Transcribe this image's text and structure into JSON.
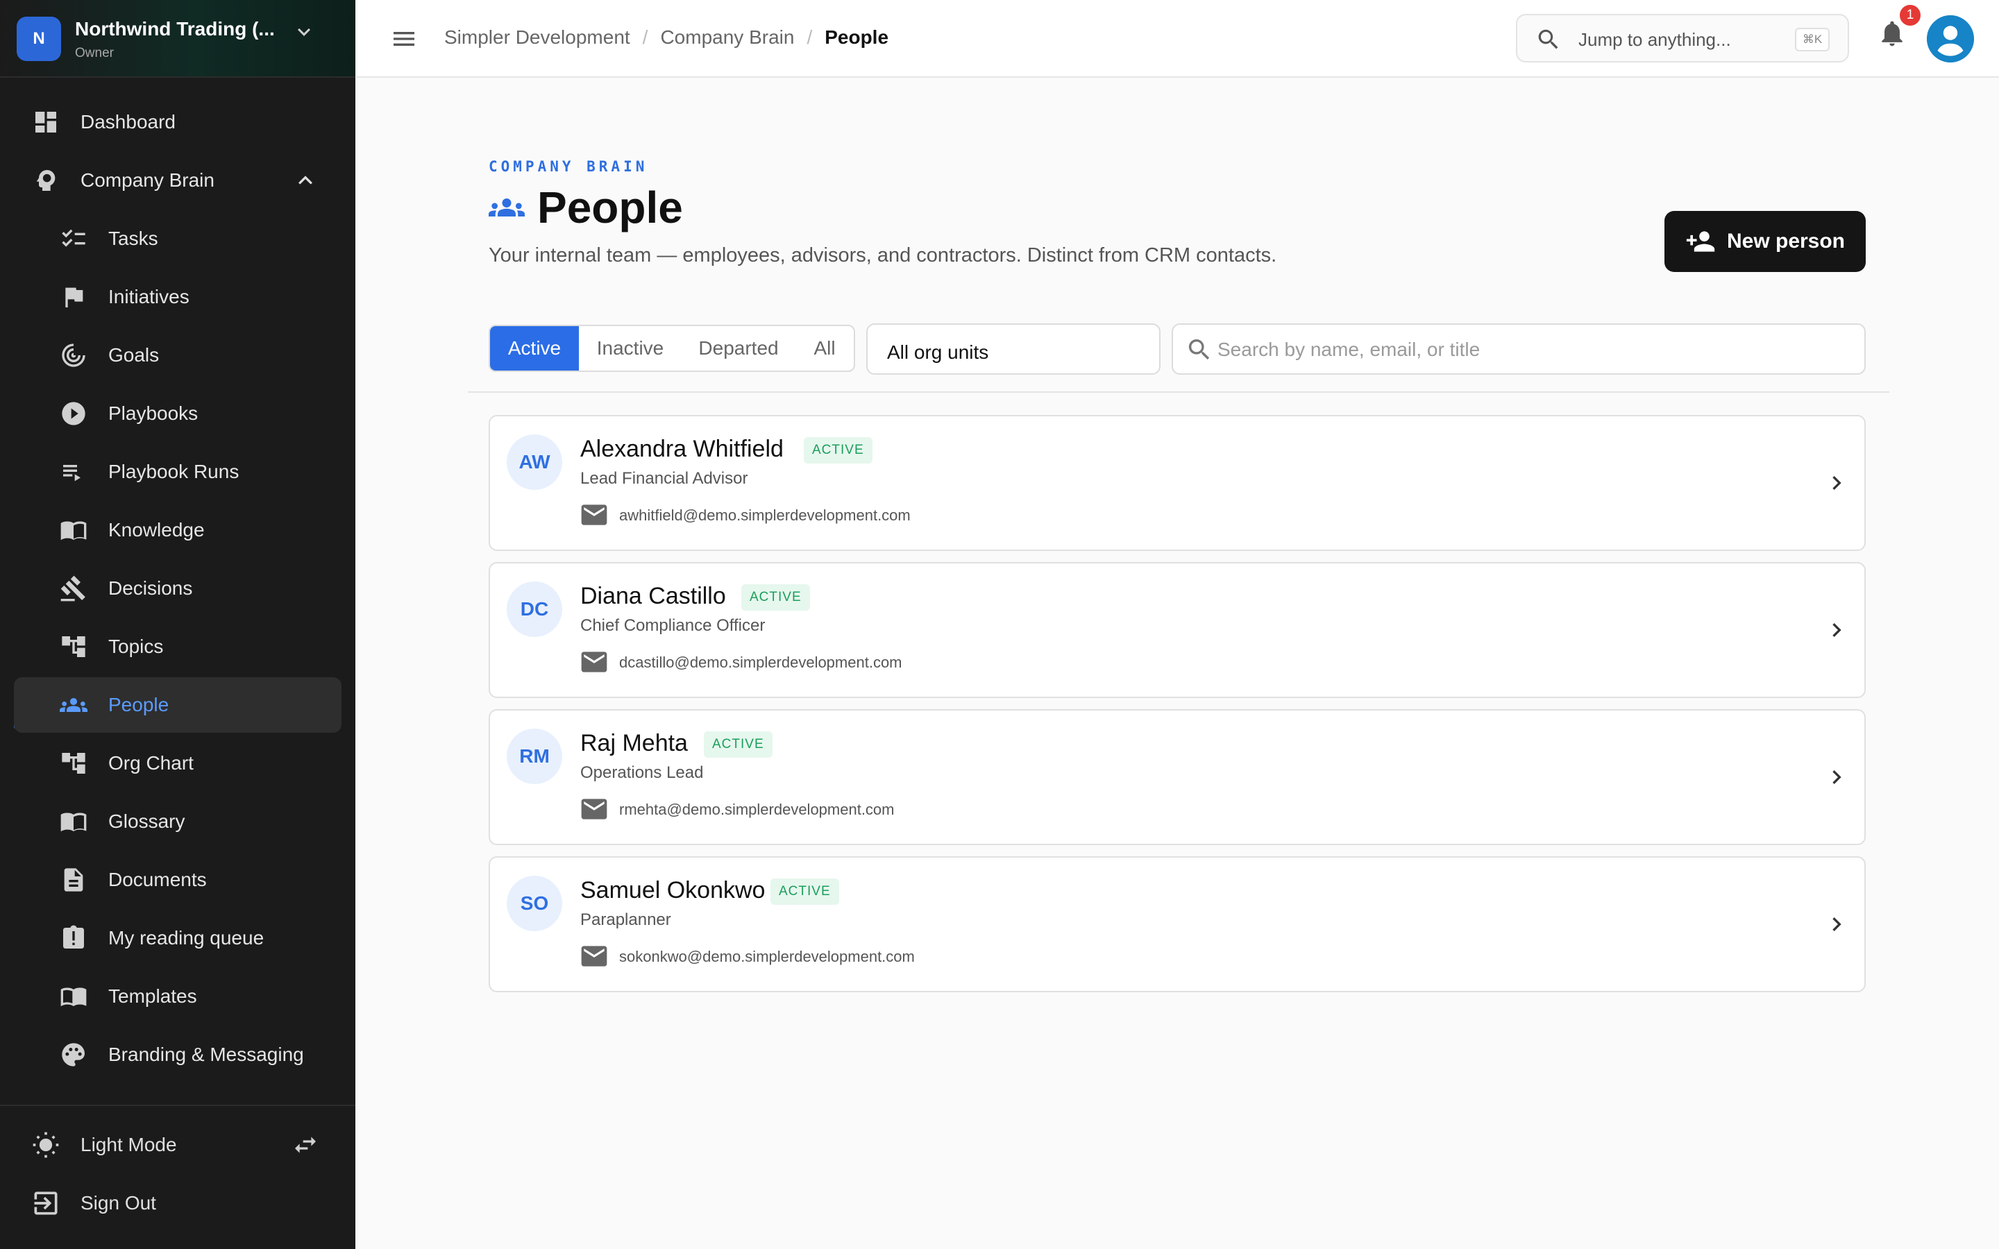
{
  "workspace": {
    "avatar": "N",
    "name": "Northwind Trading (...",
    "role": "Owner"
  },
  "sidebar": {
    "items": [
      {
        "label": "Dashboard",
        "icon": "dashboard-icon"
      },
      {
        "label": "Company Brain",
        "icon": "brain-icon",
        "expanded": true
      },
      {
        "label": "Tasks",
        "icon": "tasks-icon"
      },
      {
        "label": "Initiatives",
        "icon": "flag-icon"
      },
      {
        "label": "Goals",
        "icon": "target-icon"
      },
      {
        "label": "Playbooks",
        "icon": "play-icon"
      },
      {
        "label": "Playbook Runs",
        "icon": "playlist-icon"
      },
      {
        "label": "Knowledge",
        "icon": "book-icon"
      },
      {
        "label": "Decisions",
        "icon": "gavel-icon"
      },
      {
        "label": "Topics",
        "icon": "tree-icon"
      },
      {
        "label": "People",
        "icon": "people-icon",
        "active": true
      },
      {
        "label": "Org Chart",
        "icon": "org-chart-icon"
      },
      {
        "label": "Glossary",
        "icon": "glossary-icon"
      },
      {
        "label": "Documents",
        "icon": "document-icon"
      },
      {
        "label": "My reading queue",
        "icon": "reading-queue-icon"
      },
      {
        "label": "Templates",
        "icon": "templates-icon"
      },
      {
        "label": "Branding & Messaging",
        "icon": "palette-icon"
      }
    ],
    "footer": {
      "theme_label": "Light Mode",
      "signout_label": "Sign Out"
    }
  },
  "topbar": {
    "breadcrumbs": [
      "Simpler Development",
      "Company Brain",
      "People"
    ],
    "search_placeholder": "Jump to anything...",
    "search_shortcut": "⌘K",
    "notification_count": "1"
  },
  "page": {
    "eyebrow": "COMPANY BRAIN",
    "title": "People",
    "subtitle": "Your internal team — employees, advisors, and contractors. Distinct from CRM contacts.",
    "new_button": "New person"
  },
  "filters": {
    "status_tabs": [
      "Active",
      "Inactive",
      "Departed",
      "All"
    ],
    "selected_status": "Active",
    "org_unit": "All org units",
    "search_placeholder": "Search by name, email, or title"
  },
  "people": [
    {
      "initials": "AW",
      "name": "Alexandra Whitfield",
      "status": "ACTIVE",
      "title": "Lead Financial Advisor",
      "email": "awhitfield@demo.simplerdevelopment.com"
    },
    {
      "initials": "DC",
      "name": "Diana Castillo",
      "status": "ACTIVE",
      "title": "Chief Compliance Officer",
      "email": "dcastillo@demo.simplerdevelopment.com"
    },
    {
      "initials": "RM",
      "name": "Raj Mehta",
      "status": "ACTIVE",
      "title": "Operations Lead",
      "email": "rmehta@demo.simplerdevelopment.com"
    },
    {
      "initials": "SO",
      "name": "Samuel Okonkwo",
      "status": "ACTIVE",
      "title": "Paraplanner",
      "email": "sokonkwo@demo.simplerdevelopment.com"
    }
  ],
  "colors": {
    "accent": "#2b6de6",
    "sidebar_bg": "#1b1b1b",
    "active_badge": "#1b9e5a"
  }
}
